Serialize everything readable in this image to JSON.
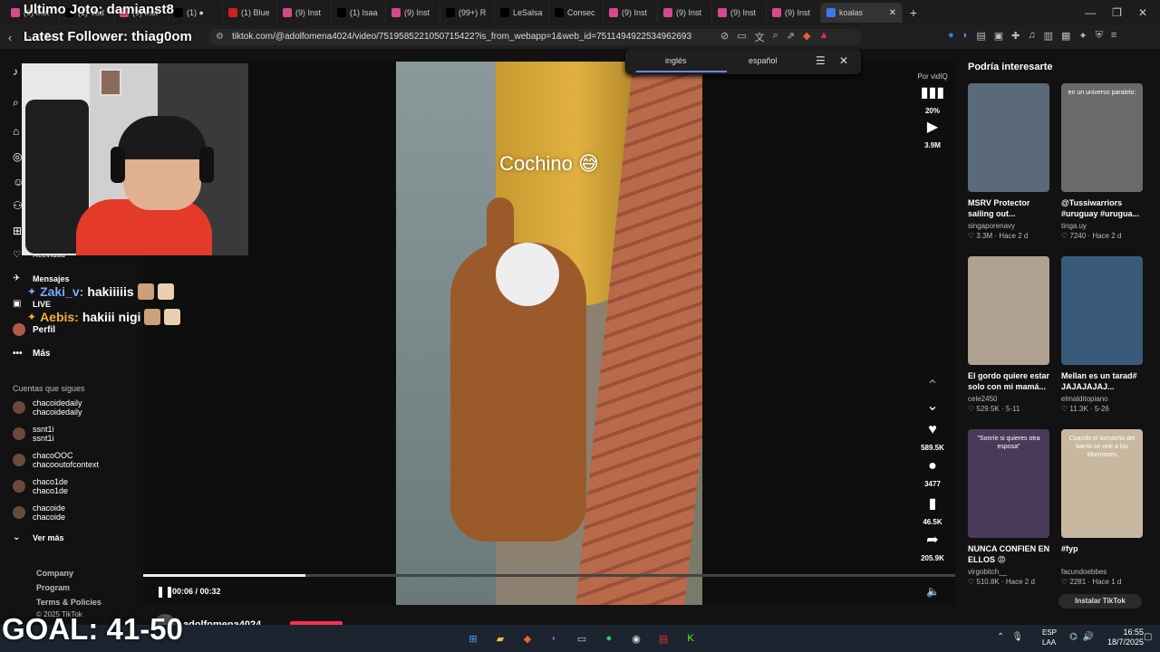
{
  "browser": {
    "tabs": [
      {
        "label": "(9) Inst",
        "color": "#d44a8a"
      },
      {
        "label": "(1) Vad",
        "color": "#000000"
      },
      {
        "label": "(9) Inst",
        "color": "#d44a8a"
      },
      {
        "label": "(1) ●",
        "color": "#000000"
      },
      {
        "label": "(1) Blue",
        "color": "#cc2222"
      },
      {
        "label": "(9) Inst",
        "color": "#d44a8a"
      },
      {
        "label": "(1) Isaa",
        "color": "#000000"
      },
      {
        "label": "(9) Inst",
        "color": "#d44a8a"
      },
      {
        "label": "(99+) R",
        "color": "#000000"
      },
      {
        "label": "LeSalsa",
        "color": "#000000"
      },
      {
        "label": "Consec",
        "color": "#000000"
      },
      {
        "label": "(9) Inst",
        "color": "#d44a8a"
      },
      {
        "label": "(9) Inst",
        "color": "#d44a8a"
      },
      {
        "label": "(9) Inst",
        "color": "#d44a8a"
      },
      {
        "label": "(9) Inst",
        "color": "#d44a8a"
      },
      {
        "label": "koalas",
        "color": "#3a7ae8"
      }
    ],
    "url": "tiktok.com/@adolfomena4024/video/7519585221050715422?is_from_webapp=1&web_id=7511494922534962693"
  },
  "overlay": {
    "title": "Ultimo Joto: damianst8",
    "follower": "Latest Follower: thiag0om",
    "goal": "GOAL: 41-50"
  },
  "chat": [
    {
      "user": "Zaki_v:",
      "msg": "hakiiiiis",
      "color": "#7aa8ff"
    },
    {
      "user": "Aebis:",
      "msg": "hakiii nigi",
      "color": "#f0b030"
    }
  ],
  "leftnav": {
    "activity": "Actividad",
    "messages": "Mensajes",
    "live": "LIVE",
    "profile": "Perfil",
    "more": "Más",
    "following_title": "Cuentas que sigues",
    "following": [
      {
        "name": "chacoidedaily",
        "handle": "chacoidedaily"
      },
      {
        "name": "ssnt1i",
        "handle": "ssnt1i"
      },
      {
        "name": "chacoOOC",
        "handle": "chacooutofcontext"
      },
      {
        "name": "chaco1de",
        "handle": "chaco1de"
      },
      {
        "name": "chacoide",
        "handle": "chacoide"
      }
    ],
    "see_more": "Ver más",
    "footer": [
      "Company",
      "Program",
      "Terms & Policies"
    ],
    "copyright": "© 2025 TikTok"
  },
  "translator": {
    "from": "inglés",
    "to": "español"
  },
  "video": {
    "caption": "Cochino 😅",
    "time": "00:06 / 00:32",
    "progress": 0.2,
    "author": "adolfomena4024"
  },
  "rail": {
    "by": "Por vidIQ",
    "stat_pct": "20%",
    "views": "3.9M",
    "likes": "589.5K",
    "comments": "3477",
    "saves": "46.5K",
    "shares": "205.9K"
  },
  "suggestions": {
    "title": "Podría interesarte",
    "items": [
      {
        "caption": "MSRV Protector sailing out...",
        "author": "singaporenavy",
        "likes": "3.3M",
        "ago": "Hace 2 d",
        "bg": "#5a6a7a",
        "overlay": ""
      },
      {
        "caption": "@Tussiwarriors #uruguay #urugua...",
        "author": "tinga.uy",
        "likes": "7240",
        "ago": "Hace 2 d",
        "bg": "#6a6a6a",
        "overlay": "en un universo paralelo:"
      },
      {
        "caption": "El gordo quiere estar solo con mi mamá...",
        "author": "cele2450",
        "likes": "529.5K",
        "ago": "5-11",
        "bg": "#b0a090",
        "overlay": ""
      },
      {
        "caption": "Mellan es un tarad# JAJAJAJAJ...",
        "author": "elmalditopiano",
        "likes": "11.3K",
        "ago": "5-26",
        "bg": "#3a5a7a",
        "overlay": ""
      },
      {
        "caption": "NUNCA CONFIEN EN ELLOS 😡",
        "author": "virgobitch__",
        "likes": "510.8K",
        "ago": "Hace 2 d",
        "bg": "#4a3a5a",
        "overlay": "\"Sonríe si quieres otra esposa\""
      },
      {
        "caption": "#fyp",
        "author": "facundoebbes",
        "likes": "2281",
        "ago": "Hace 1 d",
        "bg": "#c8b8a0",
        "overlay": "Cuando el borracho del barrio se une a los Mormones"
      }
    ],
    "install": "Instalar TikTok"
  },
  "taskbar": {
    "lang1": "ESP",
    "lang2": "LAA",
    "time": "16:55",
    "date": "18/7/2025"
  }
}
